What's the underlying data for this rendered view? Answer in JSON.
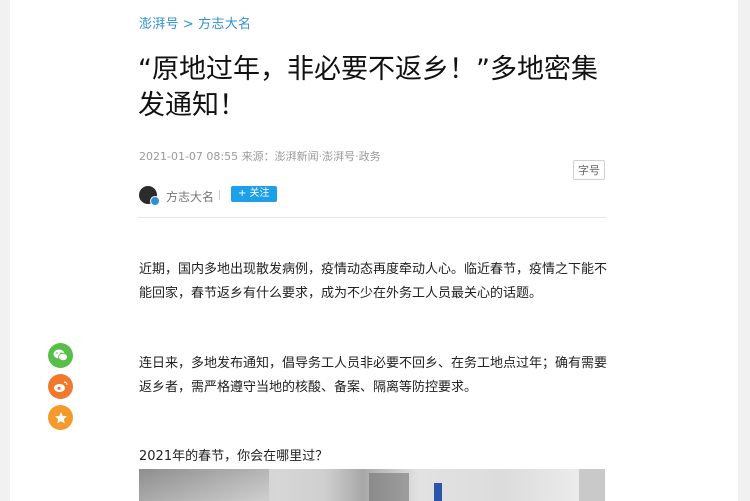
{
  "breadcrumb": {
    "channel": "澎湃号",
    "separator": ">",
    "section": "方志大名"
  },
  "article": {
    "title": "“原地过年，非必要不返乡！”多地密集发通知！",
    "date": "2021-01-07 08:55",
    "source": "来源：澎湃新闻·澎湃号·政务",
    "font_size_label": "字号"
  },
  "author": {
    "name": "方志大名",
    "follow_label": "+ 关注"
  },
  "body": {
    "paragraphs": [
      "近期，国内多地出现散发病例，疫情动态再度牵动人心。临近春节，疫情之下能不能回家，春节返乡有什么要求，成为不少在外务工人员最关心的话题。",
      "连日来，多地发布通知，倡导务工人员非必要不回乡、在务工地点过年；确有需要返乡者，需严格遵守当地的核酸、备案、隔离等防控要求。",
      "2021年的春节，你会在哪里过？"
    ]
  },
  "share": {
    "items": [
      {
        "icon": "wechat-icon",
        "color": "#57be4a"
      },
      {
        "icon": "weibo-icon",
        "color": "#ef7a2e"
      },
      {
        "icon": "star-icon",
        "color": "#f39a2a"
      }
    ]
  },
  "colors": {
    "link": "#2f8fd3",
    "follow_button": "#1ea0e8"
  }
}
